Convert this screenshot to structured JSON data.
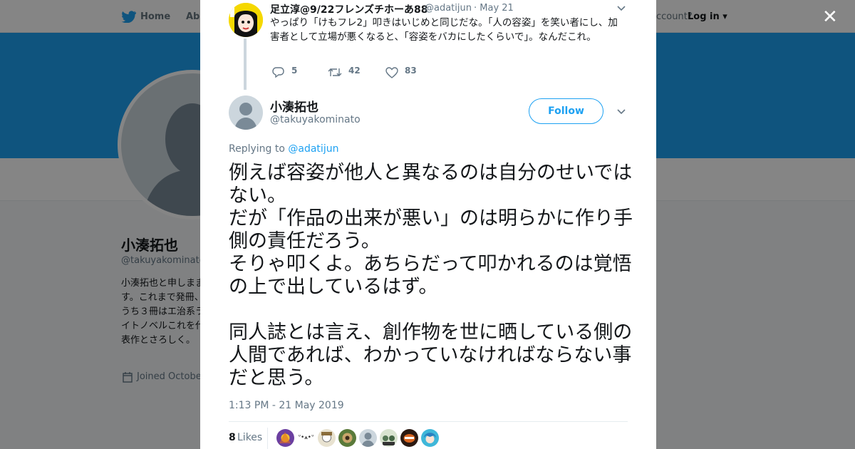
{
  "background": {
    "nav": {
      "home": "Home",
      "about": "Abo",
      "account": "ccount?",
      "login": "Log in ▾"
    },
    "profile": {
      "name": "小湊拓也",
      "handle": "@takuyakominato",
      "bio": "小湊拓也と申しまます。これまで発冊、うち３冊はエ治系ライトノベルこれを代表作とさろしく。",
      "joined": "Joined Octobe"
    }
  },
  "parent_tweet": {
    "author": "足立淳@9/22フレンズチホーあ88",
    "handle": "@adatijun",
    "date": "· May 21",
    "text": "やっぱり「けもフレ2」叩きはいじめと同じだな。「人の容姿」を笑い者にし、加害者として立場が悪くなると、「容姿をバカにしたくらいで」。なんだこれ。",
    "replies": "5",
    "retweets": "42",
    "likes": "83"
  },
  "tweet": {
    "author": "小湊拓也",
    "handle": "@takuyakominato",
    "follow_label": "Follow",
    "replying_prefix": "Replying to ",
    "replying_to": "@adatijun",
    "text": "例えば容姿が他人と異なるのは自分のせいではない。\nだが「作品の出来が悪い」のは明らかに作り手側の責任だろう。\nそりゃ叩くよ。あちらだって叩かれるのは覚悟の上で出しているはず。\n\n同人誌とは言え、創作物を世に晒している側の人間であれば、わかっていなければならない事だと思う。",
    "timestamp": "1:13 PM - 21 May 2019",
    "likes_count": "8",
    "likes_label": "Likes",
    "liker_text": "ᐡ•ﻌ•ᐡ"
  },
  "close_label": "✕",
  "colors": {
    "accent": "#1da1f2",
    "banner": "#1da1f2",
    "muted": "#657786"
  }
}
